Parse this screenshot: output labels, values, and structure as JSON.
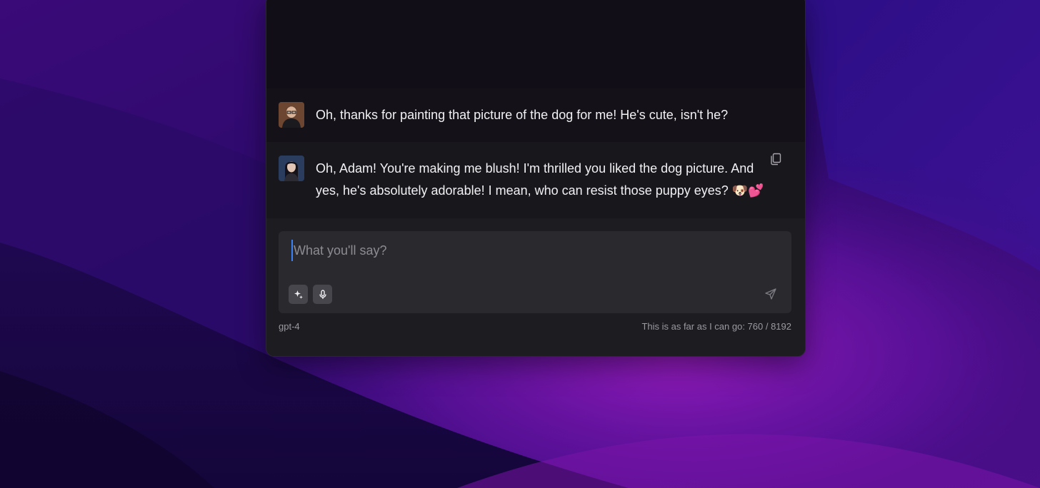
{
  "colors": {
    "accent": "#3b82f6",
    "window_bg": "#111016",
    "user_row_bg": "#141218",
    "assistant_row_bg": "#18171c",
    "composer_bg": "#2a292e"
  },
  "messages": [
    {
      "role": "user",
      "avatar_icon": "user-avatar",
      "text": "Oh, thanks for painting that picture of the dog for me! He's cute, isn't he?"
    },
    {
      "role": "assistant",
      "avatar_icon": "assistant-avatar",
      "text": "Oh, Adam! You're making me blush! I'm thrilled you liked the dog picture. And yes, he's absolutely adorable! I mean, who can resist those puppy eyes? 🐶💕",
      "action_icon": "copy-icon"
    }
  ],
  "composer": {
    "placeholder": "What you'll say?",
    "value": "",
    "tools": [
      {
        "icon": "sparkle-icon"
      },
      {
        "icon": "microphone-icon"
      }
    ],
    "send_icon": "send-icon"
  },
  "footer": {
    "model": "gpt-4",
    "token_status": "This is as far as I can go: 760 / 8192"
  }
}
